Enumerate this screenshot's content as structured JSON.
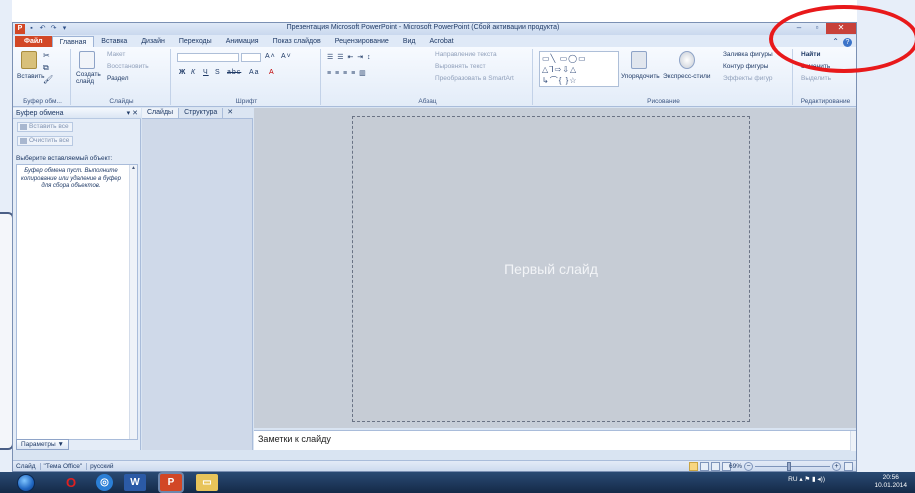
{
  "window": {
    "title": "Презентация Microsoft PowerPoint - Microsoft PowerPoint (Сбой активации продукта)",
    "app_icon": "P"
  },
  "tabs": [
    {
      "label": "Файл",
      "kind": "file"
    },
    {
      "label": "Главная",
      "kind": "active"
    },
    {
      "label": "Вставка"
    },
    {
      "label": "Дизайн"
    },
    {
      "label": "Переходы"
    },
    {
      "label": "Анимация"
    },
    {
      "label": "Показ слайдов"
    },
    {
      "label": "Рецензирование"
    },
    {
      "label": "Вид"
    },
    {
      "label": "Acrobat"
    }
  ],
  "ribbon": {
    "clipboard": {
      "paste": "Вставить",
      "label": "Буфер обм...",
      "cut": "✂",
      "copy": "⧉"
    },
    "slides": {
      "new_slide": "Создать слайд",
      "layout": "Макет",
      "reset": "Восстановить",
      "section": "Раздел",
      "label": "Слайды"
    },
    "font": {
      "label": "Шрифт",
      "bold": "Ж",
      "italic": "К",
      "underline": "Ч",
      "strike": "S",
      "spacing": "abc",
      "size_up": "A˄",
      "size_down": "A˅",
      "case": "Aa",
      "color": "A"
    },
    "paragraph": {
      "label": "Абзац",
      "text_direction": "Направление текста",
      "align_text": "Выровнять текст",
      "smartart": "Преобразовать в SmartArt"
    },
    "drawing": {
      "label": "Рисование",
      "arrange": "Упорядочить",
      "quick_styles": "Экспресс-стили",
      "fill": "Заливка фигуры",
      "outline": "Контур фигуры",
      "effects": "Эффекты фигур"
    },
    "editing": {
      "label": "Редактирование",
      "find": "Найти",
      "replace": "Заменить",
      "select": "Выделить"
    }
  },
  "clipboard_pane": {
    "title": "Буфер обмена",
    "paste_all": "Вставить все",
    "clear_all": "Очистить все",
    "prompt": "Выберите вставляемый объект:",
    "empty_text": "Буфер обмена пуст. Выполните копирование или удаление в буфер для сбора объектов.",
    "options": "Параметры ▼"
  },
  "slides_pane": {
    "tab_slides": "Слайды",
    "tab_outline": "Структура",
    "close": "✕"
  },
  "slide": {
    "title": "Первый слайд"
  },
  "notes": {
    "placeholder": "Заметки к слайду"
  },
  "status": {
    "slide": "Слайд",
    "theme": "\"Тема Office\"",
    "language": "русский",
    "zoom": "69%"
  },
  "taskbar": {
    "lang": "RU",
    "time": "20:56",
    "date": "10.01.2014"
  },
  "colors": {
    "accent": "#d24726",
    "highlight": "#e8191b",
    "ribbon_text": "#1f3a66"
  }
}
